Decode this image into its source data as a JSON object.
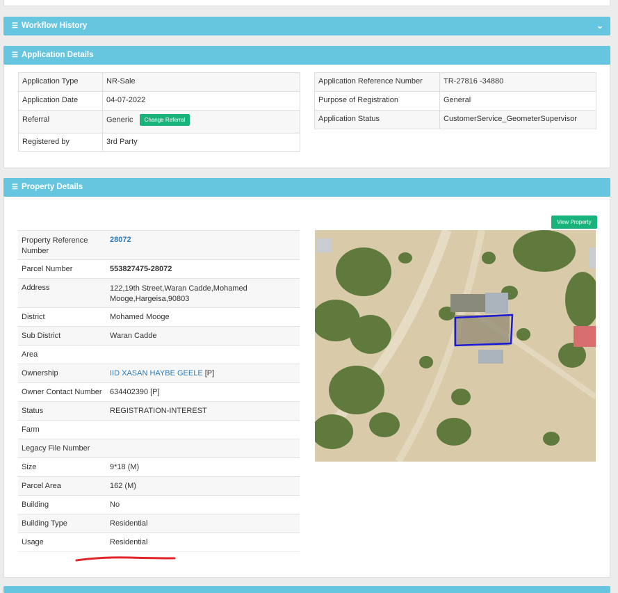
{
  "workflow": {
    "title": "Workflow History"
  },
  "application": {
    "title": "Application Details",
    "left": [
      {
        "label": "Application Type",
        "value": "NR-Sale"
      },
      {
        "label": "Application Date",
        "value": "04-07-2022"
      },
      {
        "label": "Referral",
        "value": "Generic",
        "button": "Change Referral"
      },
      {
        "label": "Registered by",
        "value": "3rd Party"
      }
    ],
    "right": [
      {
        "label": "Application Reference Number",
        "value": "TR-27816 -34880"
      },
      {
        "label": "Purpose of Registration",
        "value": "General"
      },
      {
        "label": "Application Status",
        "value": "CustomerService_GeometerSupervisor"
      }
    ]
  },
  "property": {
    "title": "Property Details",
    "view_button": "View Property",
    "rows": [
      {
        "label": "Property Reference Number",
        "value": "28072"
      },
      {
        "label": "Parcel Number",
        "value": "553827475-28072"
      },
      {
        "label": "Address",
        "value": "122,19th Street,Waran Cadde,Mohamed Mooge,Hargeisa,90803"
      },
      {
        "label": "District",
        "value": "Mohamed Mooge"
      },
      {
        "label": "Sub District",
        "value": "Waran Cadde"
      },
      {
        "label": "Area",
        "value": ""
      },
      {
        "label": "Ownership",
        "value": "IID XASAN HAYBE GEELE",
        "suffix": " [P]"
      },
      {
        "label": "Owner Contact Number",
        "value": "634402390 [P]"
      },
      {
        "label": "Status",
        "value": "REGISTRATION-INTEREST"
      },
      {
        "label": "Farm",
        "value": ""
      },
      {
        "label": "Legacy File Number",
        "value": ""
      },
      {
        "label": "Size",
        "value": "9*18 (M)"
      },
      {
        "label": "Parcel Area",
        "value": "162 (M)"
      },
      {
        "label": "Building",
        "value": "No"
      },
      {
        "label": "Building Type",
        "value": "Residential"
      },
      {
        "label": "Usage",
        "value": "Residential"
      }
    ]
  },
  "colors": {
    "header": "#66c6df",
    "button": "#18b37a",
    "link": "#2b7bb9",
    "parcel": "#1a1ad6",
    "annotation": "#e0262b"
  }
}
